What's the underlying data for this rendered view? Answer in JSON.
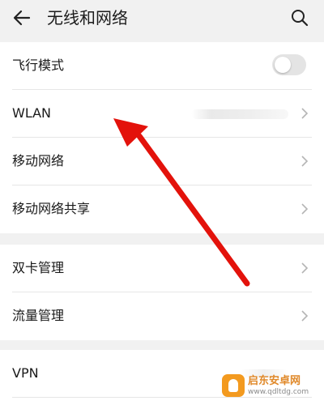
{
  "header": {
    "title": "无线和网络",
    "back_icon": "arrow-left-icon",
    "search_icon": "search-icon"
  },
  "rows": [
    {
      "label": "飞行模式",
      "control": "toggle",
      "toggle_on": false
    },
    {
      "label": "WLAN",
      "control": "chevron",
      "value_redacted": true
    },
    {
      "label": "移动网络",
      "control": "chevron"
    },
    {
      "label": "移动网络共享",
      "control": "chevron"
    },
    {
      "label": "双卡管理",
      "control": "chevron"
    },
    {
      "label": "流量管理",
      "control": "chevron"
    },
    {
      "label": "VPN",
      "control": "chevron",
      "value_redacted": true
    }
  ],
  "annotation": {
    "type": "red-arrow",
    "target": "WLAN",
    "color": "#e3120b"
  },
  "watermark": {
    "name": "启东安卓网",
    "url": "www.qdltdg.com",
    "color": "#f39a1f"
  },
  "colors": {
    "background": "#f1f1f1",
    "card": "#ffffff",
    "divider": "#e6e6e6",
    "chevron": "#b5b5b5"
  }
}
